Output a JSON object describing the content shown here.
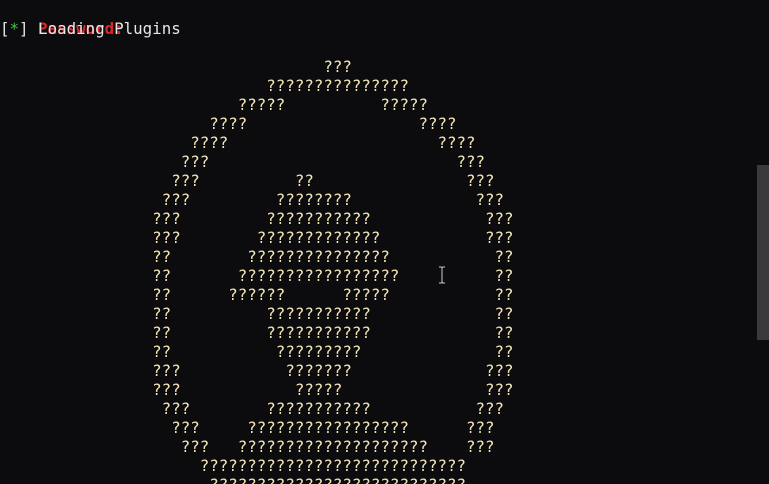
{
  "terminal": {
    "password_prompt": "Password:",
    "status_open_bracket": "[",
    "status_star": "*",
    "status_close_bracket": "]",
    "status_text": " Loading Plugins"
  },
  "ascii_art": [
    "                                  ???",
    "                            ???????????????",
    "                         ?????          ?????",
    "                      ????                  ????",
    "                    ????                      ????",
    "                   ???                          ???",
    "                  ???          ??                ???",
    "                 ???         ????????             ???",
    "                ???         ???????????            ???",
    "                ???        ?????????????           ???",
    "                ??        ???????????????           ??",
    "                ??       ?????????????????          ??",
    "                ??      ??????      ?????           ??",
    "                ??          ???????????             ??",
    "                ??          ???????????             ??",
    "                ??           ?????????              ??",
    "                ???           ???????              ???",
    "                ???            ?????               ???",
    "                 ???        ???????????           ???",
    "                  ???     ?????????????????      ???",
    "                   ???   ????????????????????    ???",
    "                     ????????????????????????????",
    "                      ???????????????????????????"
  ],
  "colors": {
    "background": "#0c0c0e",
    "prompt_red": "#e0262b",
    "star_green": "#3cc83c",
    "art_text": "#f5e6b8"
  },
  "icons": {
    "mouse_cursor": "ibeam-cursor-icon"
  }
}
